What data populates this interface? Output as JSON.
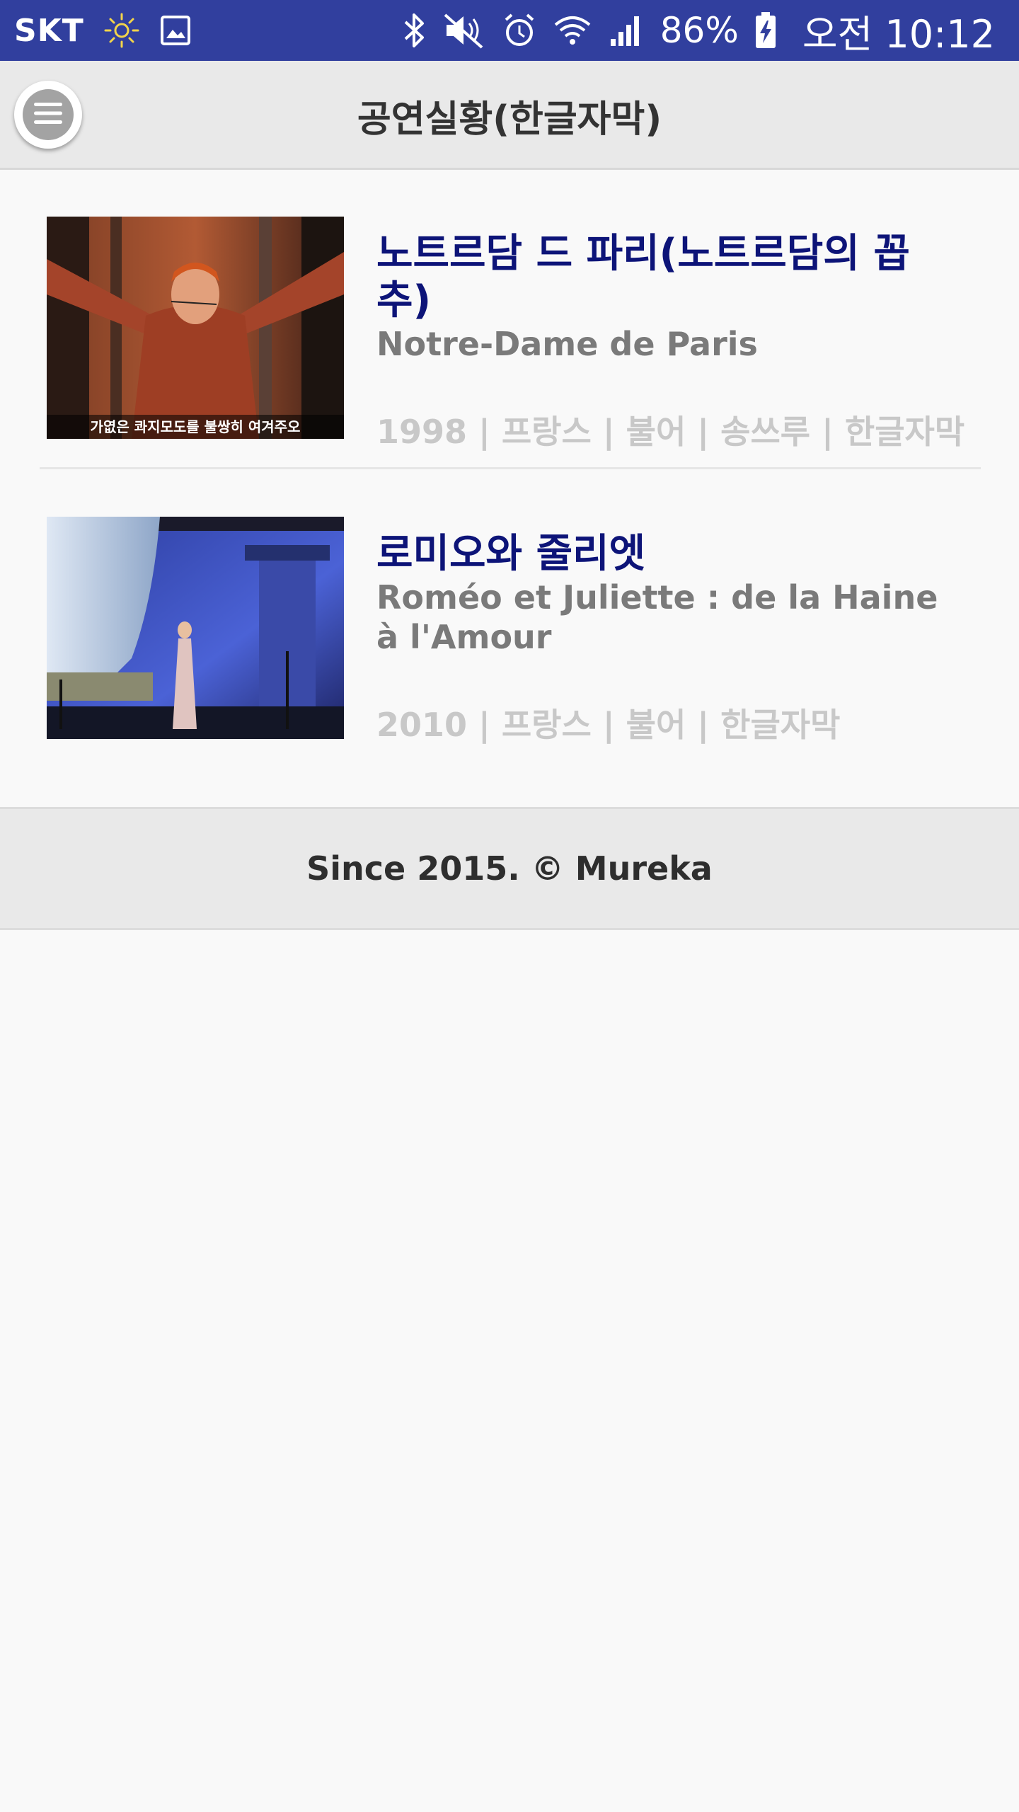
{
  "status_bar": {
    "carrier": "SKT",
    "battery_percent": "86%",
    "time": "오전 10:12",
    "icons": [
      "brightness-icon",
      "image-icon",
      "bluetooth-icon",
      "mute-icon",
      "alarm-icon",
      "wifi-icon",
      "signal-icon",
      "battery-charging-icon"
    ]
  },
  "header": {
    "title": "공연실황(한글자막)",
    "menu_icon": "menu-icon"
  },
  "performances": [
    {
      "title": "노트르담 드 파리(노트르담의 꼽추)",
      "subtitle": "Notre-Dame de Paris",
      "meta": "1998 | 프랑스 | 불어 | 송쓰루 | 한글자막",
      "thumbnail_caption": "가엾은 콰지모도를 불쌍히 여겨주오"
    },
    {
      "title": "로미오와 줄리엣",
      "subtitle": "Roméo et Juliette : de la Haine à l'Amour",
      "meta": "2010 | 프랑스 | 불어 | 한글자막"
    }
  ],
  "footer": {
    "text": "Since 2015. © Mureka"
  },
  "colors": {
    "status_bar": "#313f9e",
    "title": "#0d1478",
    "subtitle": "#7a7a7a",
    "meta": "#c8c8c8"
  }
}
